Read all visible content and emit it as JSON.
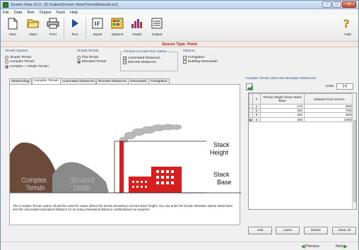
{
  "window": {
    "title": "Screen View 10.0 - [C:\\Lakes\\Screen View\\Tutorial\\tutorial.scr]",
    "controls": {
      "minimize": "–",
      "maximize": "□",
      "close": "✕"
    }
  },
  "menu": [
    "File",
    "Data",
    "Run",
    "Output",
    "Tools",
    "Help"
  ],
  "toolbar": {
    "new": "New",
    "open": "Open",
    "print": "Print",
    "run": "Run",
    "inputs": "Inputs",
    "options": "Options",
    "graph": "Graph",
    "output": "Output",
    "help": "Help"
  },
  "source_type": "Source Type: Point",
  "terrain_options": {
    "title": "Terrain Options",
    "items": [
      "Simple Terrain",
      "Complex Terrain",
      "Complex + Simple Terrain"
    ],
    "selected": "Complex + Simple Terrain"
  },
  "simple_terrain": {
    "title": "Simple Terrain",
    "items": [
      "Flat Terrain",
      "Elevated Terrain"
    ],
    "selected": "Elevated Terrain"
  },
  "choose_option": {
    "title": "Choose At Least One Option",
    "items": [
      {
        "label": "Automated Distances",
        "checked": true
      },
      {
        "label": "Discrete Distances",
        "checked": false
      }
    ]
  },
  "options": {
    "title": "Options",
    "items": [
      {
        "label": "Fumigation",
        "checked": false
      },
      {
        "label": "Building Downwash",
        "checked": false
      }
    ]
  },
  "tabs": [
    "Meteorology",
    "Complex Terrain",
    "Automated Distances",
    "Discrete Distances",
    "Downwash",
    "Fumigation"
  ],
  "active_tab": "Complex Terrain",
  "illustration": {
    "stack_height": [
      "Stack",
      "Height"
    ],
    "stack_base": [
      "Stack",
      "Base"
    ],
    "complex_terrain": [
      "Complex",
      "Terrain"
    ],
    "elevated_terrain": [
      "Elevated",
      "Terrain"
    ]
  },
  "panel_description": "The Complex Terrain option should be used for cases where the terrain elevations exceed stack height. You can enter the terrain elevation above stack base and the associated downwind distance for as many downwind distance combinations as required.",
  "discrete_panel": {
    "title": "Complex Terrain (Discrete Receptor Distances)",
    "units_label": "Units:",
    "units_value": "[m]",
    "columns": [
      "#",
      "Terrain Height Above Stack Base",
      "Distance from Source"
    ],
    "rows": [
      {
        "n": "1",
        "height": "175",
        "distance": "5000"
      },
      {
        "n": "2",
        "height": "200",
        "distance": "7000"
      },
      {
        "n": "3",
        "height": "250",
        "distance": "8000"
      },
      {
        "n": "4",
        "height": "260",
        "distance": "10000"
      }
    ],
    "current_row_marker": "▶",
    "buttons": {
      "add": "Add",
      "insert": "Insert",
      "delete": "Delete",
      "clear_all": "Clear All"
    }
  },
  "navigation": {
    "previous": "Previous",
    "next": "Next"
  }
}
